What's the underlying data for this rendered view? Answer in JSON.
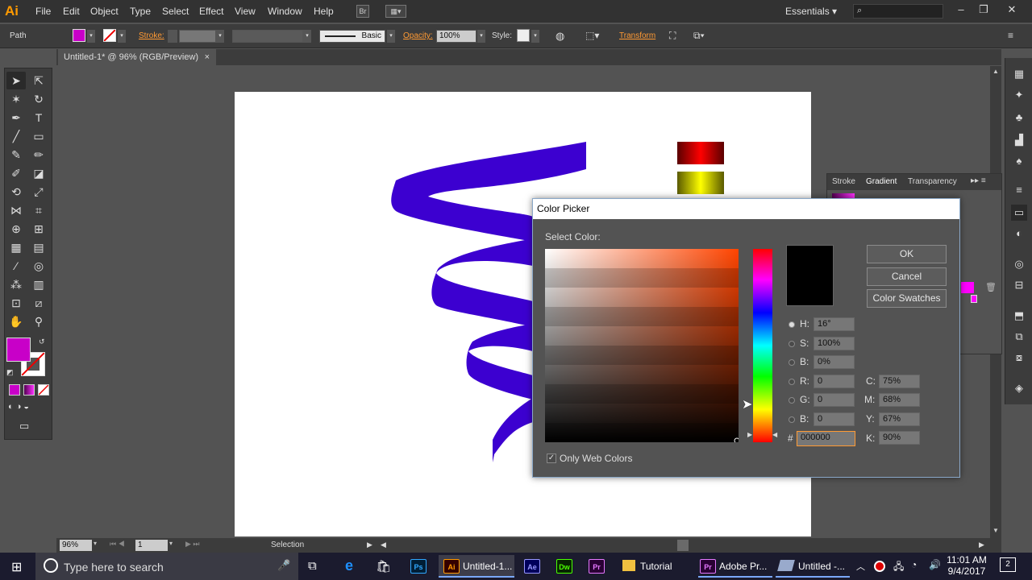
{
  "app": {
    "logo": "Ai"
  },
  "menu": [
    "File",
    "Edit",
    "Object",
    "Type",
    "Select",
    "Effect",
    "View",
    "Window",
    "Help"
  ],
  "menu_extra": {
    "br": "Br",
    "workspace": "Essentials"
  },
  "control": {
    "selection_label": "Path",
    "stroke_label": "Stroke:",
    "profile": "Basic",
    "opacity_label": "Opacity:",
    "opacity_value": "100%",
    "style_label": "Style:",
    "transform_label": "Transform",
    "fill_color": "#c800c8"
  },
  "document": {
    "tab": "Untitled-1* @ 96% (RGB/Preview)",
    "close": "×"
  },
  "gradient_panel": {
    "tabs": [
      "Stroke",
      "Gradient",
      "Transparency"
    ]
  },
  "color_picker": {
    "title": "Color Picker",
    "select_label": "Select Color:",
    "ok": "OK",
    "cancel": "Cancel",
    "swatches": "Color Swatches",
    "h_label": "H:",
    "h": "16°",
    "s_label": "S:",
    "s": "100%",
    "b_label": "B:",
    "b": "0%",
    "r_label": "R:",
    "r": "0",
    "g_label": "G:",
    "g": "0",
    "bb_label": "B:",
    "bb": "0",
    "hex_label": "#",
    "hex": "000000",
    "c_label": "C:",
    "c": "75%",
    "m_label": "M:",
    "m": "68%",
    "y_label": "Y:",
    "y": "67%",
    "k_label": "K:",
    "k": "90%",
    "web_only": "Only Web Colors",
    "selected_color": "#000000"
  },
  "status": {
    "zoom": "96%",
    "page": "1",
    "tool": "Selection"
  },
  "taskbar": {
    "search": "Type here to search",
    "apps": {
      "ai": "Untitled-1...",
      "tutorial": "Tutorial",
      "premiere": "Adobe Pr...",
      "untitled2": "Untitled -..."
    },
    "time": "11:01 AM",
    "date": "9/4/2017",
    "notifications": "2"
  },
  "colors": {
    "ribbon": "#3c00d0",
    "accent": "#ff9a00"
  }
}
